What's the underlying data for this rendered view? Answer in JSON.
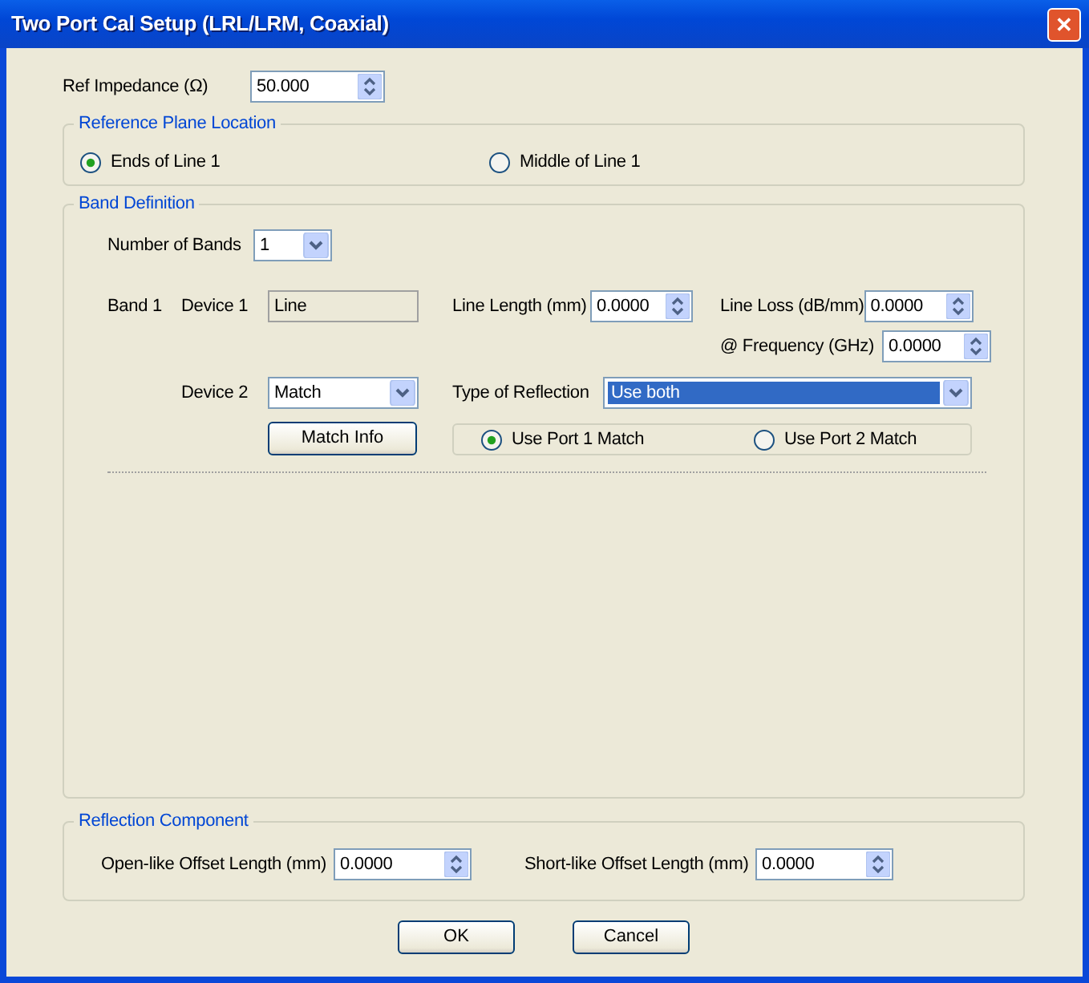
{
  "window": {
    "title": "Two Port Cal Setup (LRL/LRM, Coaxial)",
    "close_symbol": "✕"
  },
  "ref_impedance": {
    "label": "Ref Impedance (Ω)",
    "value": "50.000"
  },
  "reference_plane_location": {
    "title": "Reference Plane Location",
    "options": [
      {
        "label": "Ends of Line 1",
        "selected": true
      },
      {
        "label": "Middle of Line 1",
        "selected": false
      }
    ]
  },
  "band_definition": {
    "title": "Band Definition",
    "number_of_bands": {
      "label": "Number of Bands",
      "value": "1"
    },
    "bands": [
      {
        "label": "Band 1",
        "device_1": {
          "label": "Device 1",
          "value": "Line",
          "disabled": true
        },
        "line_length": {
          "label": "Line Length (mm)",
          "value": "0.0000"
        },
        "line_loss": {
          "label": "Line Loss (dB/mm)",
          "value": "0.0000"
        },
        "frequency": {
          "label": "@ Frequency (GHz)",
          "value": "0.0000"
        },
        "device_2": {
          "label": "Device 2",
          "value": "Match"
        },
        "type_of_reflection": {
          "label": "Type of Reflection",
          "value": "Use both",
          "highlighted": true
        },
        "match_info_button": "Match Info",
        "match_options": [
          {
            "label": "Use Port 1 Match",
            "selected": true
          },
          {
            "label": "Use Port 2 Match",
            "selected": false
          }
        ]
      }
    ]
  },
  "reflection_component": {
    "title": "Reflection Component",
    "fields": [
      {
        "label": "Open-like Offset Length (mm)",
        "value": "0.0000"
      },
      {
        "label": "Short-like Offset Length (mm)",
        "value": "0.0000"
      }
    ]
  },
  "buttons": [
    "OK",
    "Cancel"
  ]
}
